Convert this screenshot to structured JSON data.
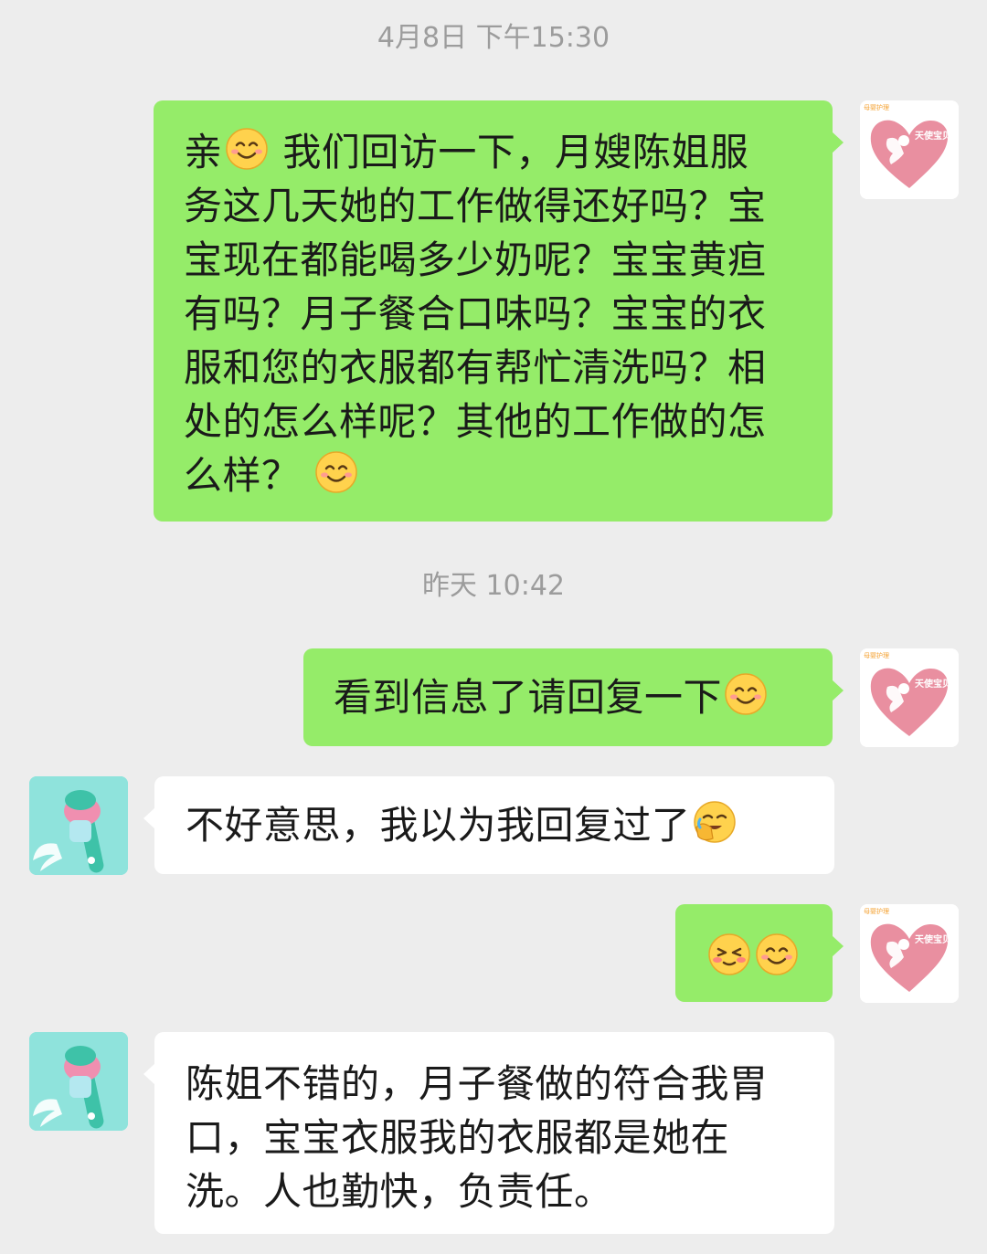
{
  "timestamps": [
    "4月8日 下午15:30",
    "昨天 10:42"
  ],
  "messages": [
    {
      "sender": "me",
      "lines": [
        {
          "pre": "亲",
          "emoji": "smile-emoji",
          "post": " 我们回访一下，月嫂陈姐服"
        },
        {
          "text": "务这几天她的工作做得还好吗？宝"
        },
        {
          "text": "宝现在都能喝多少奶呢？宝宝黄疸"
        },
        {
          "text": "有吗？月子餐合口味吗？宝宝的衣"
        },
        {
          "text": "服和您的衣服都有帮忙清洗吗？相"
        },
        {
          "text": "处的怎么样呢？其他的工作做的怎"
        },
        {
          "pre": "么样？ ",
          "emoji": "smile-emoji",
          "post": ""
        }
      ]
    },
    {
      "sender": "me",
      "text": "看到信息了请回复一下",
      "trailing_emoji": "smile-emoji"
    },
    {
      "sender": "them",
      "text": "不好意思，我以为我回复过了",
      "trailing_emoji": "facepalm-laugh-emoji"
    },
    {
      "sender": "me",
      "emojis": [
        "blush-emoji",
        "smile-emoji"
      ]
    },
    {
      "sender": "them",
      "lines": [
        {
          "text": "陈姐不错的，月子餐做的符合我胃"
        },
        {
          "text": "口，宝宝衣服我的衣服都是她在"
        },
        {
          "text": "洗。人也勤快，负责任。"
        }
      ]
    }
  ],
  "shop_avatar": {
    "label": "天使宝贝",
    "small_label": "母婴护理",
    "colors": {
      "heart": "#e98fa0",
      "text": "#f4a233"
    }
  },
  "user_avatar": {
    "colors": {
      "bg": "#8fe3dc",
      "hair": "#f08fb0",
      "cap": "#3ec2a8"
    }
  },
  "colors": {
    "background": "#ededed",
    "my_bubble": "#95ec69",
    "their_bubble": "#ffffff",
    "timestamp_text": "#9c9c9c"
  }
}
